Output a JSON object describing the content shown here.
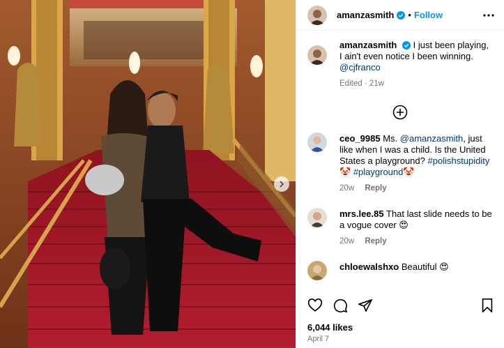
{
  "post": {
    "author": "amanzasmith",
    "follow_label": "Follow",
    "caption_text": "I just been playing, I ain't even notice I been winning.",
    "caption_mention": "@cjfranco",
    "caption_meta": "Edited · 21w"
  },
  "comments": [
    {
      "user": "ceo_9985",
      "text_1": "Ms.",
      "mention": "@amanzasmith",
      "text_2": ", just like when I was a child. Is the United States a playground?",
      "hash_1": "#polishstupidity",
      "emoji_1": "🤡",
      "hash_2": "#playground",
      "emoji_2": "🤡",
      "age": "20w",
      "reply_label": "Reply"
    },
    {
      "user": "mrs.lee.85",
      "text": "That last slide needs to be a vogue cover",
      "emoji": "😍",
      "age": "20w",
      "reply_label": "Reply"
    },
    {
      "user": "chloewalshxo",
      "text": "Beautiful",
      "emoji": "😍"
    }
  ],
  "footer": {
    "likes": "6,044 likes",
    "date": "April 7"
  },
  "icons": {
    "verified": "verified-badge-icon",
    "more": "more-options-icon",
    "load_more": "plus-circle-icon",
    "like": "heart-icon",
    "comment": "comment-icon",
    "share": "share-icon",
    "save": "bookmark-icon",
    "next": "chevron-right-icon"
  },
  "colors": {
    "accent": "#0095f6",
    "link": "#00376b",
    "muted": "#737373",
    "carpet": "#a3182a"
  }
}
